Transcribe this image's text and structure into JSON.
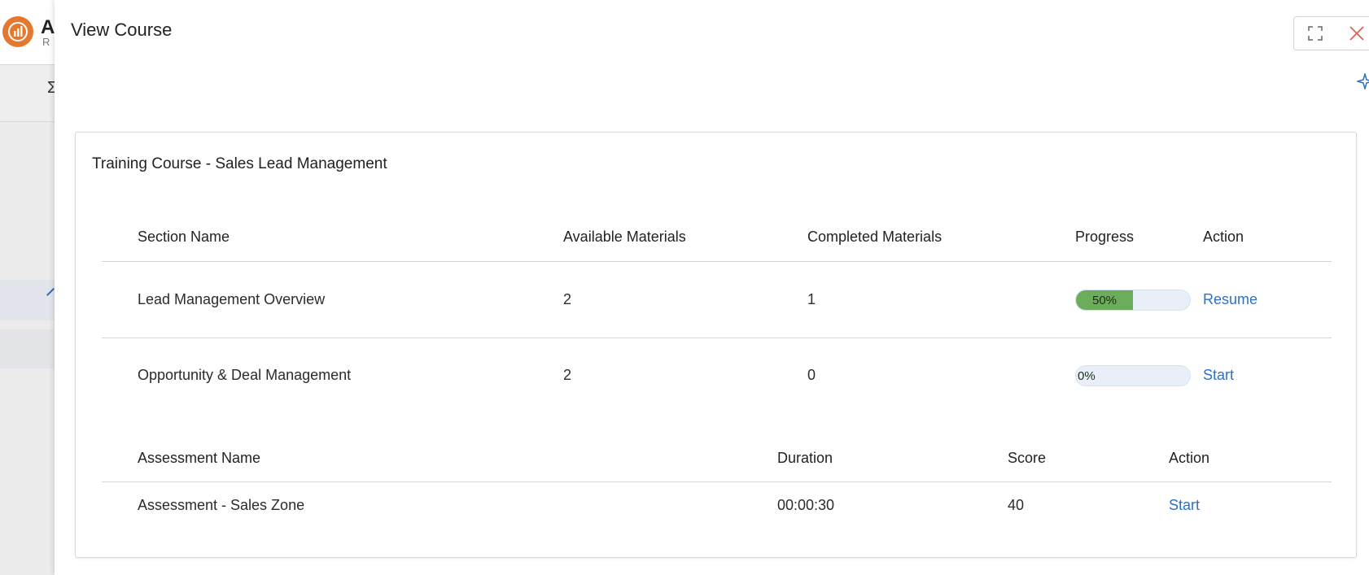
{
  "background": {
    "app_initial": "A",
    "app_initial_sub": "R",
    "sigma_glyph": "Σ"
  },
  "drawer": {
    "title": "View Course"
  },
  "card": {
    "title": "Training Course - Sales Lead Management",
    "sections_table": {
      "headers": {
        "section_name": "Section Name",
        "available": "Available Materials",
        "completed": "Completed Materials",
        "progress": "Progress",
        "action": "Action"
      },
      "rows": [
        {
          "name": "Lead Management Overview",
          "available": "2",
          "completed": "1",
          "progress_label": "50%",
          "progress_value": 0.5,
          "action": "Resume"
        },
        {
          "name": "Opportunity & Deal Management",
          "available": "2",
          "completed": "0",
          "progress_label": "0%",
          "progress_value": 0,
          "action": "Start"
        }
      ]
    },
    "assessments_table": {
      "headers": {
        "name": "Assessment Name",
        "duration": "Duration",
        "score": "Score",
        "action": "Action"
      },
      "rows": [
        {
          "name": "Assessment - Sales Zone",
          "duration": "00:00:30",
          "score": "40",
          "action": "Start"
        }
      ]
    }
  },
  "colors": {
    "accent": "#2f6fc4",
    "progress_fill": "#6cad5c",
    "progress_track": "#e8eff8",
    "close_icon": "#e05a50",
    "logo": "#e4782f"
  },
  "icons": {
    "expand": "expand-icon",
    "close": "close-icon",
    "star": "sparkle-icon",
    "logo": "app-logo-icon"
  }
}
